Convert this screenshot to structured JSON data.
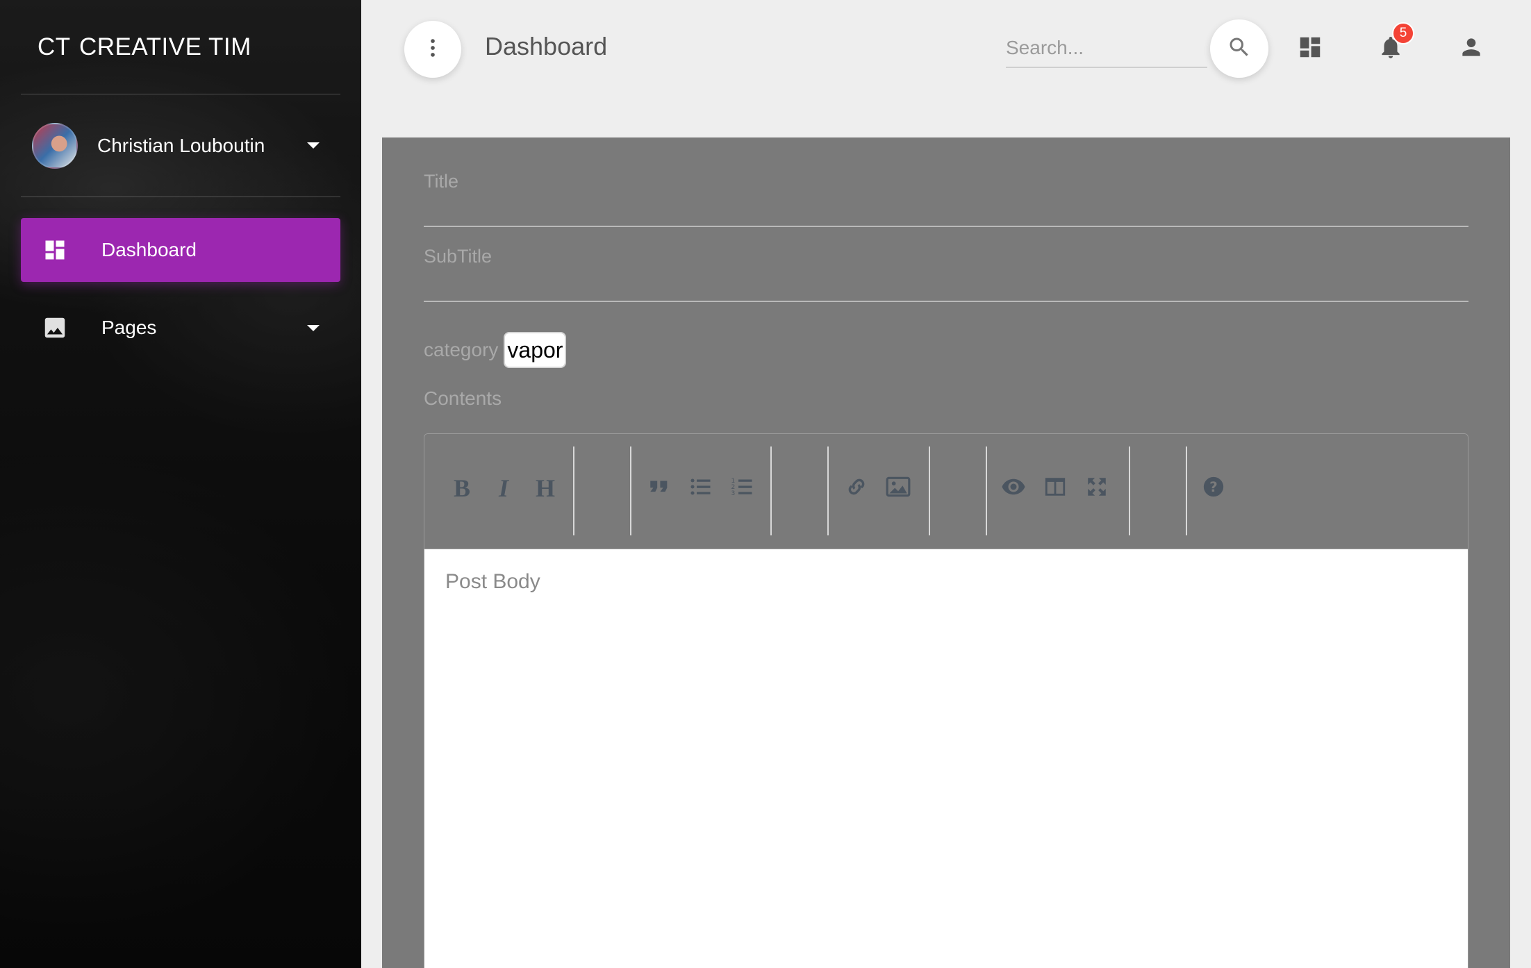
{
  "sidebar": {
    "logo_mini": "CT",
    "logo_text": "CREATIVE TIM",
    "user_name": "Christian Louboutin",
    "items": [
      {
        "label": "Dashboard",
        "icon": "dashboard-icon",
        "active": true
      },
      {
        "label": "Pages",
        "icon": "image-icon",
        "active": false
      }
    ]
  },
  "navbar": {
    "title": "Dashboard",
    "search_placeholder": "Search...",
    "notification_count": "5"
  },
  "form": {
    "title_label": "Title",
    "subtitle_label": "SubTitle",
    "category_label": "category",
    "category_value": "vapor",
    "contents_label": "Contents",
    "editor_placeholder": "Post Body"
  },
  "toolbar": {
    "buttons": [
      "bold",
      "italic",
      "heading",
      "quote",
      "unordered-list",
      "ordered-list",
      "link",
      "image",
      "preview",
      "side-by-side",
      "fullscreen",
      "guide"
    ]
  },
  "colors": {
    "accent": "#9c27b0",
    "badge": "#f44336",
    "card_bg": "#7a7a7a",
    "page_bg": "#eeeeee"
  }
}
